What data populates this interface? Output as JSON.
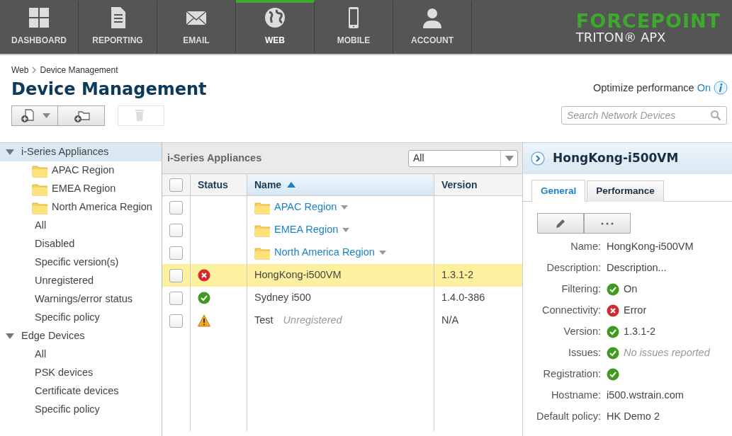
{
  "nav": [
    {
      "label": "DASHBOARD",
      "kind": "grid",
      "selected": false
    },
    {
      "label": "REPORTING",
      "kind": "document",
      "selected": false
    },
    {
      "label": "EMAIL",
      "kind": "envelope",
      "selected": false
    },
    {
      "label": "WEB",
      "kind": "globe",
      "selected": true
    },
    {
      "label": "MOBILE",
      "kind": "phone",
      "selected": false
    },
    {
      "label": "ACCOUNT",
      "kind": "person",
      "selected": false
    }
  ],
  "brand": {
    "name": "FORCEPOINT",
    "product": "TRITON® APX"
  },
  "breadcrumb": [
    "Web",
    "Device Management"
  ],
  "title": "Device Management",
  "optimize": {
    "label": "Optimize performance",
    "value": "On"
  },
  "toolbar": [
    {
      "kind": "device",
      "caret": true,
      "disabled": false
    },
    {
      "kind": "folder",
      "caret": false,
      "disabled": false
    },
    {
      "kind": "trash",
      "caret": false,
      "disabled": true
    }
  ],
  "search": {
    "placeholder": "Search Network Devices"
  },
  "tree": [
    {
      "label": "i-Series Appliances",
      "expanded": true,
      "selected": true,
      "children": [
        {
          "label": "APAC Region",
          "kind": "folder"
        },
        {
          "label": "EMEA Region",
          "kind": "folder"
        },
        {
          "label": "North America Region",
          "kind": "folder"
        },
        {
          "label": "All",
          "kind": "filter"
        },
        {
          "label": "Disabled",
          "kind": "filter"
        },
        {
          "label": "Specific version(s)",
          "kind": "filter"
        },
        {
          "label": "Unregistered",
          "kind": "filter"
        },
        {
          "label": "Warnings/error status",
          "kind": "filter"
        },
        {
          "label": "Specific policy",
          "kind": "filter"
        }
      ]
    },
    {
      "label": "Edge Devices",
      "expanded": true,
      "selected": false,
      "children": [
        {
          "label": "All",
          "kind": "filter"
        },
        {
          "label": "PSK devices",
          "kind": "filter"
        },
        {
          "label": "Certificate devices",
          "kind": "filter"
        },
        {
          "label": "Specific policy",
          "kind": "filter"
        }
      ]
    }
  ],
  "grid": {
    "title": "i-Series Appliances",
    "filter": "All",
    "select_all": {
      "checked": false
    },
    "columns": [
      {
        "label": "Status",
        "sorted": false
      },
      {
        "label": "Name",
        "sorted": true
      },
      {
        "label": "Version",
        "sorted": false
      }
    ],
    "rows": [
      {
        "kind": "folder",
        "checked": false,
        "selected": false,
        "name": "APAC Region"
      },
      {
        "kind": "folder",
        "checked": false,
        "selected": false,
        "name": "EMEA Region"
      },
      {
        "kind": "folder",
        "checked": false,
        "selected": false,
        "name": "North America Region"
      },
      {
        "kind": "error",
        "checked": false,
        "selected": true,
        "name": "HongKong-i500VM",
        "version": "1.3.1-2"
      },
      {
        "kind": "ok",
        "checked": false,
        "selected": false,
        "name": "Sydney i500",
        "version": "1.4.0-386"
      },
      {
        "kind": "warning",
        "checked": false,
        "selected": false,
        "name": "Test",
        "note": "Unregistered",
        "version": "N/A"
      }
    ]
  },
  "details": {
    "title": "HongKong-i500VM",
    "tabs": [
      {
        "label": "General",
        "selected": true
      },
      {
        "label": "Performance",
        "selected": false
      }
    ],
    "fields": [
      {
        "label": "Name:",
        "kind": "text",
        "value": "HongKong-i500VM",
        "muted": false
      },
      {
        "label": "Description:",
        "kind": "text",
        "value": "Description...",
        "muted": false
      },
      {
        "label": "Filtering:",
        "kind": "ok",
        "value": "On",
        "muted": false
      },
      {
        "label": "Connectivity:",
        "kind": "error",
        "value": "Error",
        "muted": false
      },
      {
        "label": "Version:",
        "kind": "ok",
        "value": "1.3.1-2",
        "muted": false
      },
      {
        "label": "Issues:",
        "kind": "ok",
        "value": "No issues reported",
        "muted": true
      },
      {
        "label": "Registration:",
        "kind": "ok"
      },
      {
        "label": "Hostname:",
        "kind": "text",
        "value": "i500.wstrain.com",
        "muted": false
      },
      {
        "label": "Default policy:",
        "kind": "text",
        "value": "HK Demo 2",
        "muted": false
      }
    ]
  }
}
